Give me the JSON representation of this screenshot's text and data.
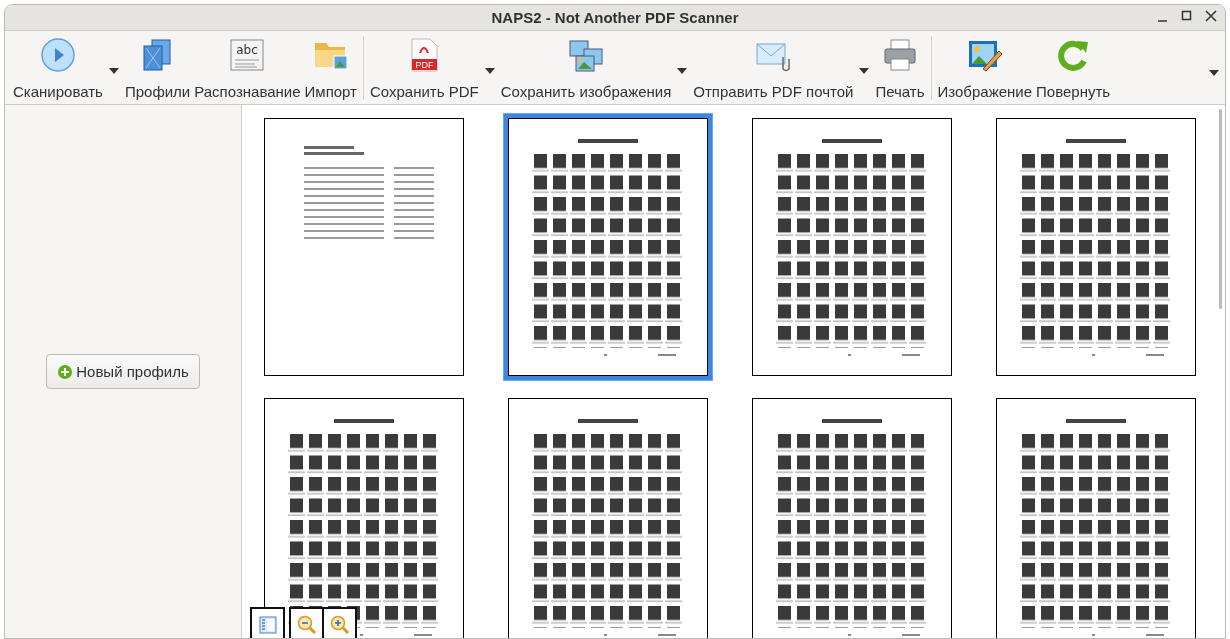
{
  "window": {
    "title": "NAPS2 - Not Another PDF Scanner"
  },
  "toolbar": {
    "items": [
      {
        "label": "Сканировать",
        "dropdown": true,
        "separator_after": false
      },
      {
        "label": "Профили",
        "dropdown": false,
        "separator_after": false
      },
      {
        "label": "Распознавание",
        "dropdown": false,
        "separator_after": false,
        "icon_text": "abc"
      },
      {
        "label": "Импорт",
        "dropdown": false,
        "separator_after": true
      },
      {
        "label": "Сохранить PDF",
        "dropdown": true,
        "separator_after": false,
        "icon_text": "PDF"
      },
      {
        "label": "Сохранить изображения",
        "dropdown": true,
        "separator_after": false
      },
      {
        "label": "Отправить PDF почтой",
        "dropdown": true,
        "separator_after": false
      },
      {
        "label": "Печать",
        "dropdown": false,
        "separator_after": true
      },
      {
        "label": "Изображение",
        "dropdown": false,
        "separator_after": false
      },
      {
        "label": "Повернуть",
        "dropdown": false,
        "separator_after": false
      }
    ],
    "overflow": true
  },
  "sidebar": {
    "new_profile_button": "Новый профиль"
  },
  "thumbnails": [
    {
      "kind": "picture",
      "selected": false
    },
    {
      "kind": "picture",
      "selected": true
    },
    {
      "kind": "picture",
      "selected": false
    },
    {
      "kind": "picture",
      "selected": false
    },
    {
      "kind": "picture",
      "selected": false
    },
    {
      "kind": "picture",
      "selected": false
    },
    {
      "kind": "picture",
      "selected": false
    },
    {
      "kind": "picture",
      "selected": false
    }
  ]
}
